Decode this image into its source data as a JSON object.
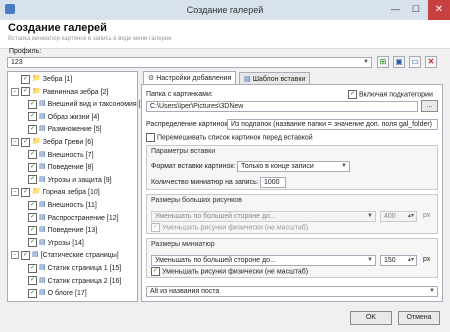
{
  "window": {
    "title": "Создание галерей"
  },
  "header": {
    "title": "Создание галерей",
    "subtitle": "Вставка миниатюр картинок в запись в виде мини-галереи"
  },
  "profile": {
    "label": "Профиль:",
    "value": "123"
  },
  "tree": {
    "items": [
      {
        "label": "Зебра [1]",
        "level": 0,
        "expander": "",
        "folder": true
      },
      {
        "label": "Равнинная зебра [2]",
        "level": 0,
        "expander": "−",
        "folder": true
      },
      {
        "label": "Внешний вид и таксономия [3]",
        "level": 1,
        "expander": "",
        "folder": false
      },
      {
        "label": "Образ жизни [4]",
        "level": 1,
        "expander": "",
        "folder": false
      },
      {
        "label": "Размножение [5]",
        "level": 1,
        "expander": "",
        "folder": false
      },
      {
        "label": "Зебра Греви [6]",
        "level": 0,
        "expander": "−",
        "folder": true
      },
      {
        "label": "Внешность [7]",
        "level": 1,
        "expander": "",
        "folder": false
      },
      {
        "label": "Поведение [8]",
        "level": 1,
        "expander": "",
        "folder": false
      },
      {
        "label": "Угрозы и защита [9]",
        "level": 1,
        "expander": "",
        "folder": false
      },
      {
        "label": "Горная зебра [10]",
        "level": 0,
        "expander": "−",
        "folder": true
      },
      {
        "label": "Внешность [11]",
        "level": 1,
        "expander": "",
        "folder": false
      },
      {
        "label": "Распространение [12]",
        "level": 1,
        "expander": "",
        "folder": false
      },
      {
        "label": "Поведение [13]",
        "level": 1,
        "expander": "",
        "folder": false
      },
      {
        "label": "Угрозы [14]",
        "level": 1,
        "expander": "",
        "folder": false
      },
      {
        "label": "[Статические страницы]",
        "level": 0,
        "expander": "−",
        "folder": false
      },
      {
        "label": "Статик страница 1 [15]",
        "level": 1,
        "expander": "",
        "folder": false
      },
      {
        "label": "Статик страница 2 [16]",
        "level": 1,
        "expander": "",
        "folder": false
      },
      {
        "label": "О блоге [17]",
        "level": 1,
        "expander": "",
        "folder": false
      }
    ]
  },
  "tabs": [
    {
      "label": "Настройки добавления",
      "active": true
    },
    {
      "label": "Шаблон вставки",
      "active": false
    }
  ],
  "settings": {
    "folder_label": "Папка с картинками:",
    "include_subfolders": "Включая подкатегории",
    "folder_path": "C:\\Users\\Iper\\Pictures\\3DNew",
    "browse": "...",
    "distribution_label": "Распределение картинок:",
    "distribution_value": "Из подпапок (название папки = значение доп. поля gal_folder)",
    "shuffle": "Перемешивать список картинок перед вставкой",
    "insert_params_title": "Параметры вставки",
    "format_label": "Формат вставки картинок:",
    "format_value": "Только в конце записи",
    "count_label": "Количество миниатюр на запись:",
    "count_value": "1000",
    "big_title": "Размеры больших рисунков",
    "big_mode": "Уменьшать по большей стороне до...",
    "big_size": "400",
    "big_unit": "px",
    "big_physical": "Уменьшать рисунки физически (не масштаб)",
    "mini_title": "Размеры миниатюр",
    "mini_mode": "Уменьшать по большей стороне до...",
    "mini_size": "150",
    "mini_unit": "px",
    "mini_physical": "Уменьшать рисунки физически (не масштаб)",
    "alt_value": "Alt из названия поста"
  },
  "buttons": {
    "ok": "OK",
    "cancel": "Отмена"
  }
}
